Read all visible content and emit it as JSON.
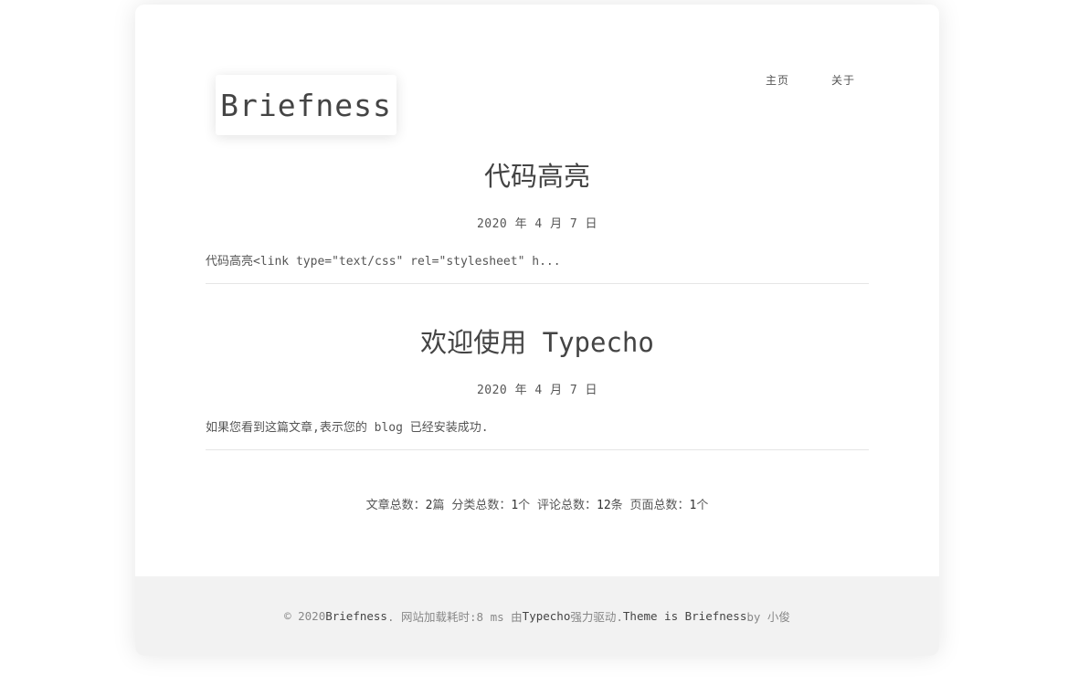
{
  "site": {
    "logo": "Briefness"
  },
  "nav": {
    "items": [
      {
        "label": "主页"
      },
      {
        "label": "关于"
      }
    ]
  },
  "posts": [
    {
      "title": "代码高亮",
      "date": "2020 年 4 月 7 日",
      "excerpt": "代码高亮<link type=\"text/css\" rel=\"stylesheet\" h..."
    },
    {
      "title": "欢迎使用 Typecho",
      "date": "2020 年 4 月 7 日",
      "excerpt": "如果您看到这篇文章,表示您的 blog 已经安装成功."
    }
  ],
  "stats": {
    "posts_label": "文章总数：",
    "posts_value": "2",
    "posts_unit": "篇",
    "categories_label": "分类总数：",
    "categories_value": "1",
    "categories_unit": "个",
    "comments_label": "评论总数：",
    "comments_value": "12",
    "comments_unit": "条",
    "pages_label": "页面总数：",
    "pages_value": "1",
    "pages_unit": "个"
  },
  "footer": {
    "copyright": "© 2020 ",
    "site_link": "Briefness",
    "load_text": ". 网站加载耗时:8 ms 由 ",
    "typecho_link": "Typecho",
    "powered_text": " 强力驱动. ",
    "theme_link": "Theme is Briefness",
    "by_text": " by 小俊"
  }
}
